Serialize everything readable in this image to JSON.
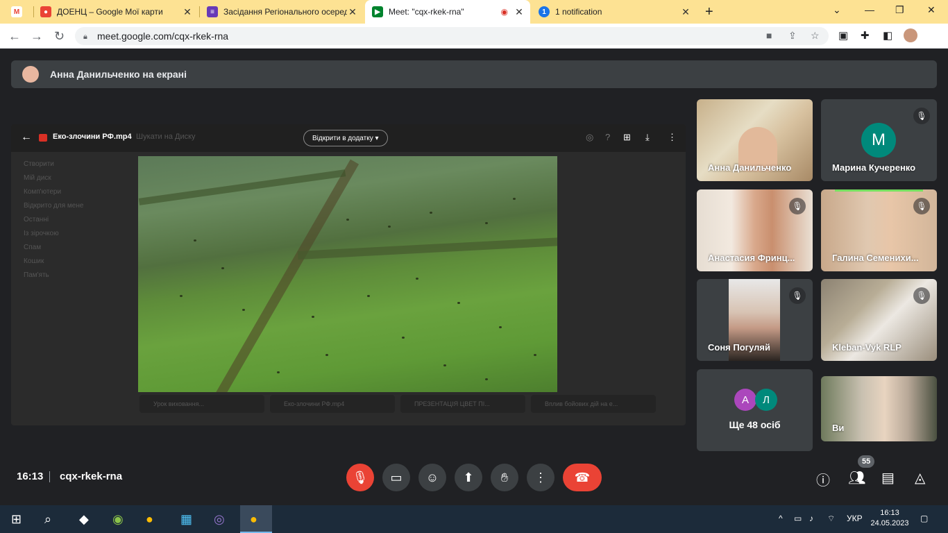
{
  "browser": {
    "tabs": [
      {
        "title": "",
        "favicon": "gmail-icon"
      },
      {
        "title": "ДОЕНЦ – Google Мої карти",
        "favicon": "maps-icon"
      },
      {
        "title": "Засідання Регіонального осеред",
        "favicon": "forms-icon"
      },
      {
        "title": "Meet: \"cqx-rkek-rna\"",
        "favicon": "meet-icon"
      },
      {
        "title": "1 notification",
        "favicon": "notification-icon"
      }
    ],
    "new_tab": "+",
    "url": "meet.google.com/cqx-rkek-rna"
  },
  "meet": {
    "presenter_text": "Анна Данильченко на екрані",
    "shared_screen": {
      "file_name": "Еко-злочини РФ.mp4",
      "search_placeholder": "Шукати на Диску",
      "open_with": "Відкрити в додатку",
      "drive_sidebar": [
        "Створити",
        "Мій диск",
        "Комп'ютери",
        "Відкрито для мене",
        "Останні",
        "Із зірочкою",
        "Спам",
        "Кошик",
        "Пам'ять"
      ],
      "bottom_files": [
        "Урок виховання...",
        "Еко-злочини РФ.mp4",
        "ПРЕЗЕНТАЦІЯ ЦВЕТ ПІ...",
        "Вплив бойових дій на е..."
      ]
    },
    "participants": [
      {
        "name": "Анна Данильченко",
        "muted": false,
        "kind": "photo"
      },
      {
        "name": "Марина Кучеренко",
        "muted": true,
        "kind": "letter",
        "letter": "М",
        "color": "#00897b"
      },
      {
        "name": "Анастасия Фринц...",
        "muted": true,
        "kind": "photo"
      },
      {
        "name": "Галина Семенихи...",
        "muted": true,
        "kind": "photo"
      },
      {
        "name": "Соня Погуляй",
        "muted": true,
        "kind": "photo"
      },
      {
        "name": "Kleban-Vyk RLP",
        "muted": true,
        "kind": "photo"
      },
      {
        "name": "Ви",
        "muted": false,
        "kind": "photo"
      }
    ],
    "others": {
      "label": "Ще 48 осіб",
      "letters": [
        "А",
        "Л"
      ],
      "colors": [
        "#ab47bc",
        "#00897b"
      ]
    },
    "clock": "16:13",
    "meeting_code": "cqx-rkek-rna",
    "participant_count": "55"
  },
  "taskbar": {
    "lang": "УКР",
    "time": "16:13",
    "date": "24.05.2023"
  }
}
